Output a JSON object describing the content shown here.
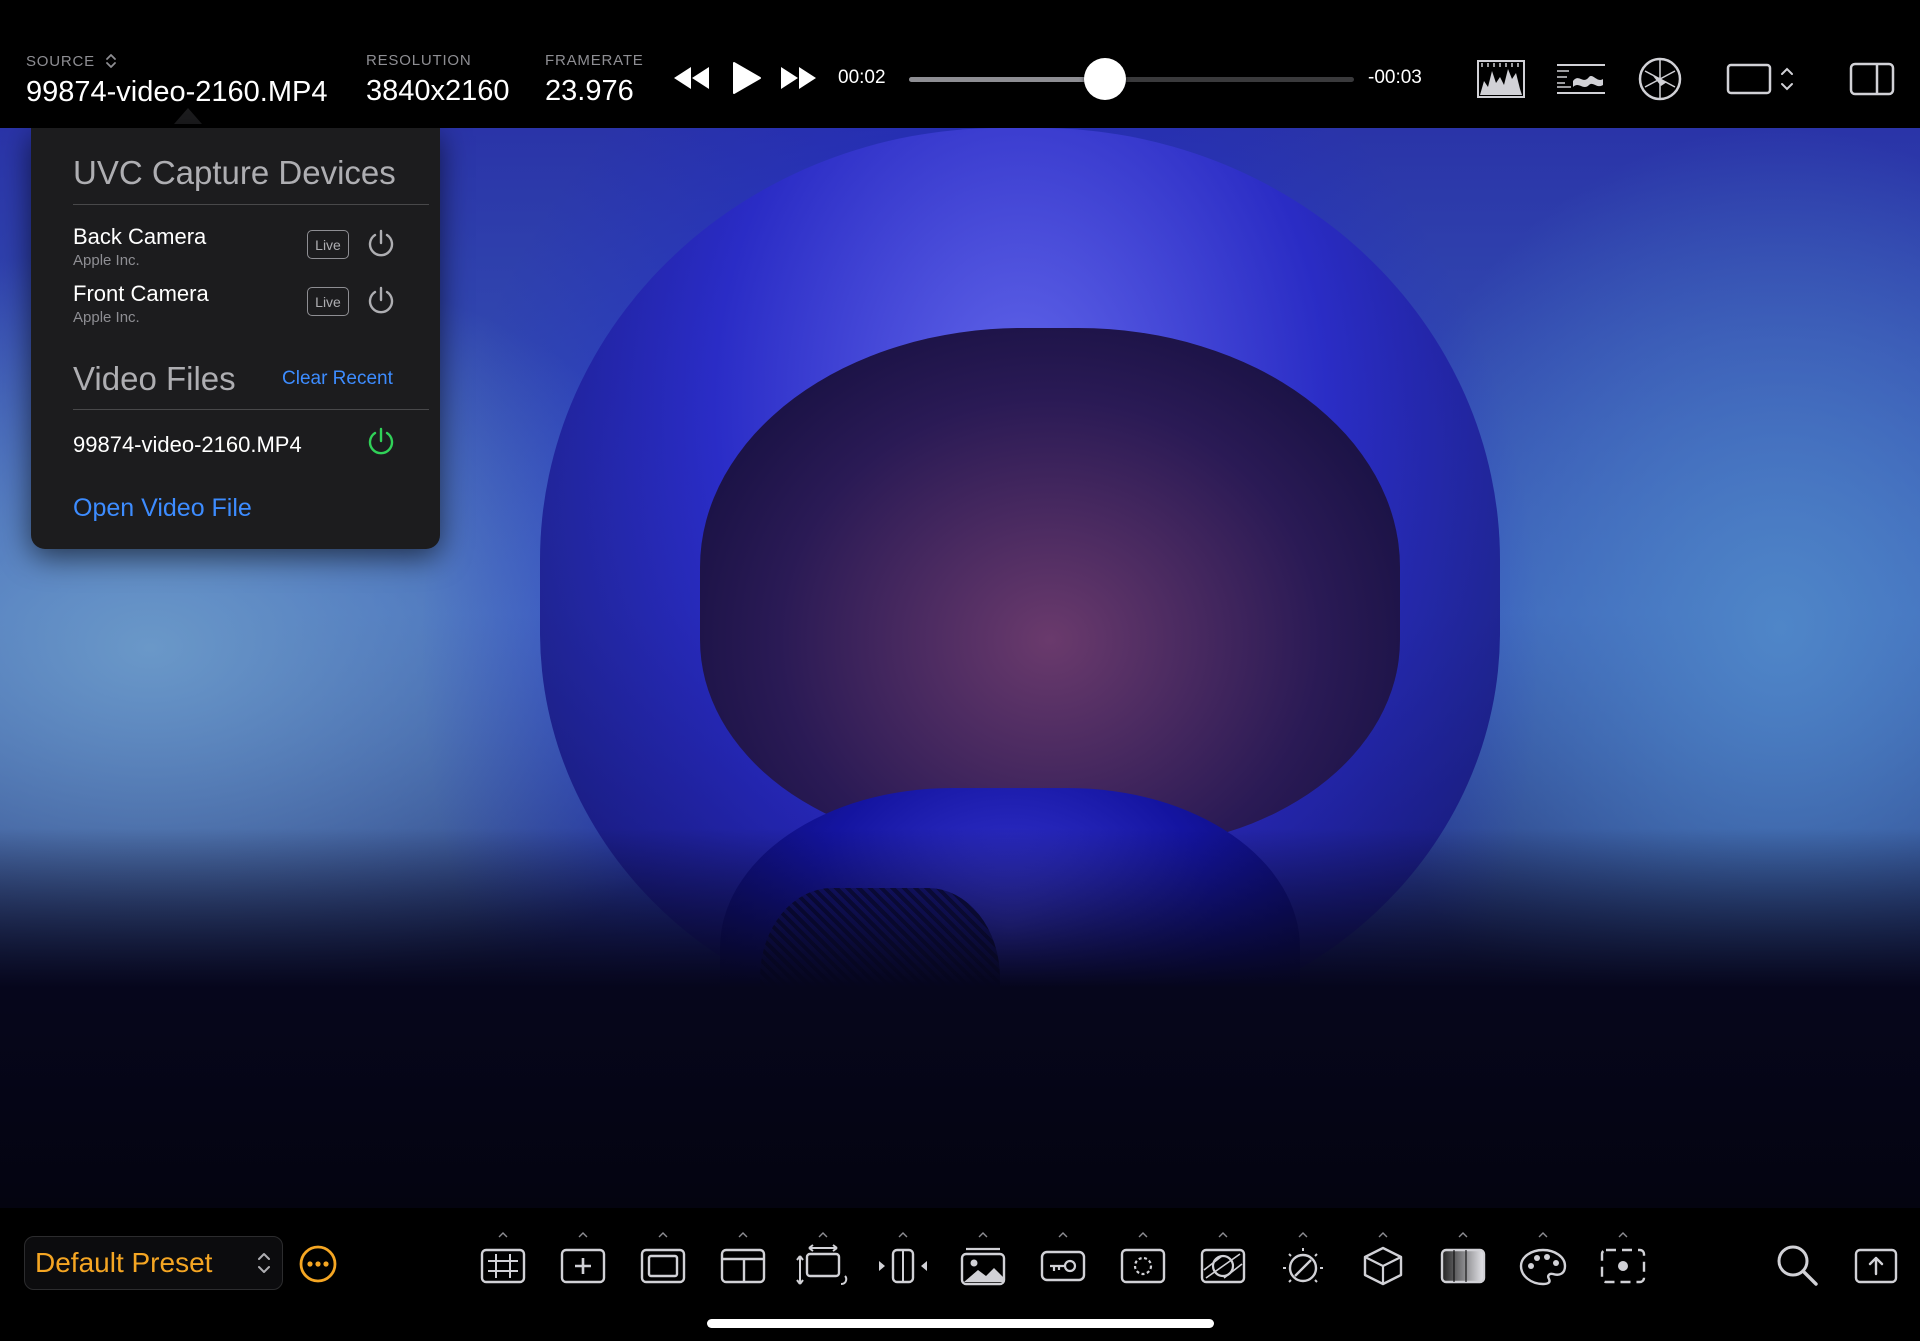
{
  "topbar": {
    "source_label": "SOURCE",
    "source_value": "99874-video-2160.MP4",
    "resolution_label": "RESOLUTION",
    "resolution_value": "3840x2160",
    "framerate_label": "FRAMERATE",
    "framerate_value": "23.976",
    "time_elapsed": "00:02",
    "time_remaining": "-00:03",
    "scrub_progress": 0.44,
    "icons": [
      "rewind-icon",
      "play-icon",
      "fast-forward-icon",
      "histogram-icon",
      "waveform-icon",
      "vectorscope-icon",
      "frame-guide-icon",
      "sidebar-toggle-icon"
    ]
  },
  "popover": {
    "uvc_title": "UVC Capture Devices",
    "devices": [
      {
        "name": "Back Camera",
        "vendor": "Apple Inc.",
        "live_label": "Live"
      },
      {
        "name": "Front Camera",
        "vendor": "Apple Inc.",
        "live_label": "Live"
      }
    ],
    "video_files_title": "Video Files",
    "clear_recent": "Clear Recent",
    "files": [
      {
        "name": "99874-video-2160.MP4",
        "active": true
      }
    ],
    "open_file": "Open Video File"
  },
  "bottombar": {
    "preset": "Default Preset",
    "tools": [
      "grid-overlay-icon",
      "center-marker-icon",
      "safe-area-icon",
      "aspect-ratio-icon",
      "anamorphic-desqueeze-icon",
      "flip-icon",
      "image-overlay-icon",
      "luma-key-icon",
      "focus-peaking-icon",
      "false-color-icon",
      "zebra-icon",
      "lut-cube-icon",
      "gray-ramp-icon",
      "color-palette-icon",
      "spot-meter-icon"
    ],
    "right_tools": [
      "zoom-icon",
      "export-icon"
    ]
  },
  "colors": {
    "accent_orange": "#f5a623",
    "link_blue": "#3d8cff",
    "active_green": "#30d158",
    "bar_bg": "#000000",
    "popover_bg": "#1c1c1e"
  }
}
